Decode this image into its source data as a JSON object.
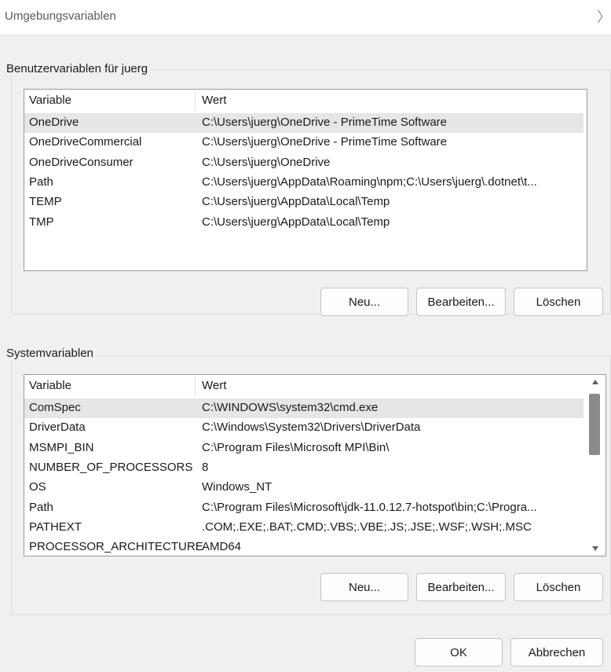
{
  "window": {
    "title": "Umgebungsvariablen",
    "close_glyph": "〉"
  },
  "user_vars": {
    "group_label": "Benutzervariablen für juerg",
    "headers": {
      "variable": "Variable",
      "value": "Wert"
    },
    "rows": [
      {
        "variable": "OneDrive",
        "value": "C:\\Users\\juerg\\OneDrive - PrimeTime Software",
        "selected": true
      },
      {
        "variable": "OneDriveCommercial",
        "value": "C:\\Users\\juerg\\OneDrive - PrimeTime Software"
      },
      {
        "variable": "OneDriveConsumer",
        "value": "C:\\Users\\juerg\\OneDrive"
      },
      {
        "variable": "Path",
        "value": "C:\\Users\\juerg\\AppData\\Roaming\\npm;C:\\Users\\juerg\\.dotnet\\t..."
      },
      {
        "variable": "TEMP",
        "value": "C:\\Users\\juerg\\AppData\\Local\\Temp"
      },
      {
        "variable": "TMP",
        "value": "C:\\Users\\juerg\\AppData\\Local\\Temp"
      }
    ],
    "buttons": {
      "new": "Neu...",
      "edit": "Bearbeiten...",
      "delete": "Löschen"
    }
  },
  "system_vars": {
    "group_label": "Systemvariablen",
    "headers": {
      "variable": "Variable",
      "value": "Wert"
    },
    "rows": [
      {
        "variable": "ComSpec",
        "value": "C:\\WINDOWS\\system32\\cmd.exe",
        "selected": true
      },
      {
        "variable": "DriverData",
        "value": "C:\\Windows\\System32\\Drivers\\DriverData"
      },
      {
        "variable": "MSMPI_BIN",
        "value": "C:\\Program Files\\Microsoft MPI\\Bin\\"
      },
      {
        "variable": "NUMBER_OF_PROCESSORS",
        "value": "8"
      },
      {
        "variable": "OS",
        "value": "Windows_NT"
      },
      {
        "variable": "Path",
        "value": "C:\\Program Files\\Microsoft\\jdk-11.0.12.7-hotspot\\bin;C:\\Progra..."
      },
      {
        "variable": "PATHEXT",
        "value": ".COM;.EXE;.BAT;.CMD;.VBS;.VBE;.JS;.JSE;.WSF;.WSH;.MSC"
      },
      {
        "variable": "PROCESSOR_ARCHITECTURE",
        "value": "AMD64"
      }
    ],
    "buttons": {
      "new": "Neu...",
      "edit": "Bearbeiten...",
      "delete": "Löschen"
    }
  },
  "footer": {
    "ok": "OK",
    "cancel": "Abbrechen"
  },
  "colors": {
    "selected_row": "#e6e6e6",
    "window_bg": "#f0f0f0",
    "scroll_thumb": "#8a8a8a"
  }
}
